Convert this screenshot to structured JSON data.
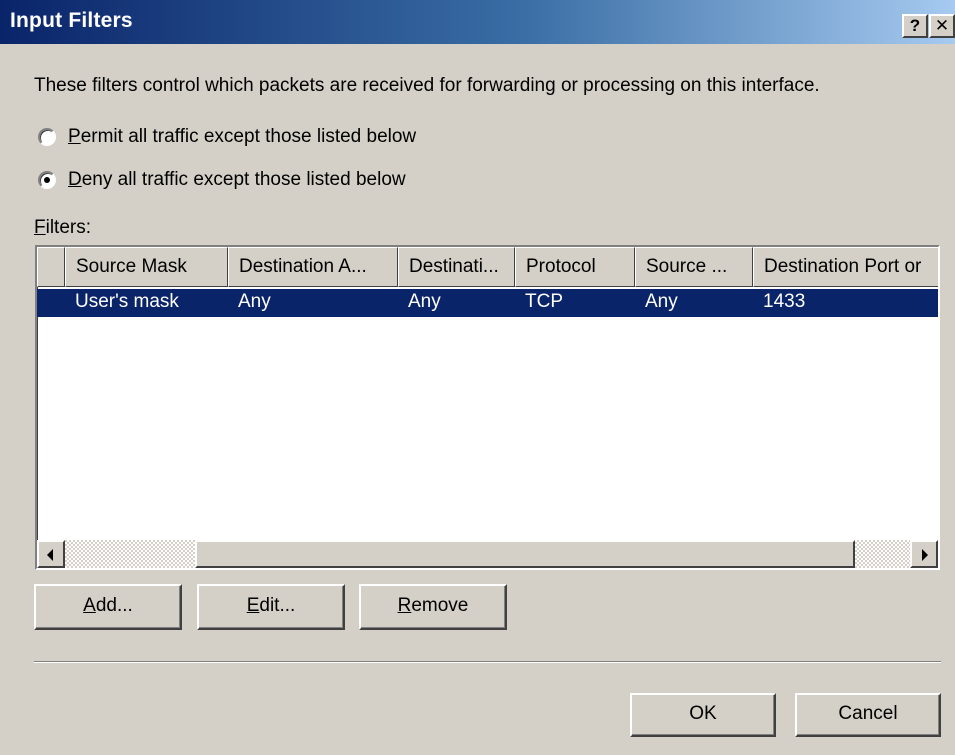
{
  "window": {
    "title": "Input Filters",
    "help_button": "?",
    "close_button": "✕"
  },
  "description": "These filters control which packets are received for forwarding or processing on this interface.",
  "radios": [
    {
      "label_access_key": "P",
      "label_rest": "ermit all traffic except those listed below",
      "checked": false
    },
    {
      "label_access_key": "D",
      "label_rest": "eny all traffic except those listed below",
      "checked": true
    }
  ],
  "filters_label": {
    "access_key": "F",
    "rest": "ilters:"
  },
  "table": {
    "columns": [
      "",
      "Source Mask",
      "Destination A...",
      "Destinati...",
      "Protocol",
      "Source ...",
      "Destination Port or"
    ],
    "rows": [
      {
        "selected": true,
        "cells": [
          "",
          "User's mask",
          "Any",
          "Any",
          "TCP",
          "Any",
          "1433"
        ]
      }
    ]
  },
  "buttons": {
    "add": {
      "access_key": "A",
      "rest": "dd..."
    },
    "edit": {
      "access_key": "E",
      "rest": "dit..."
    },
    "remove": {
      "access_key": "R",
      "rest": "emove"
    },
    "ok": "OK",
    "cancel": "Cancel"
  },
  "colors": {
    "title_bar": "#0a246a",
    "selection": "#0a246a",
    "face": "#d4d0c8"
  },
  "icons": {
    "scroll_left": "scroll-left-arrow-icon",
    "scroll_right": "scroll-right-arrow-icon"
  }
}
